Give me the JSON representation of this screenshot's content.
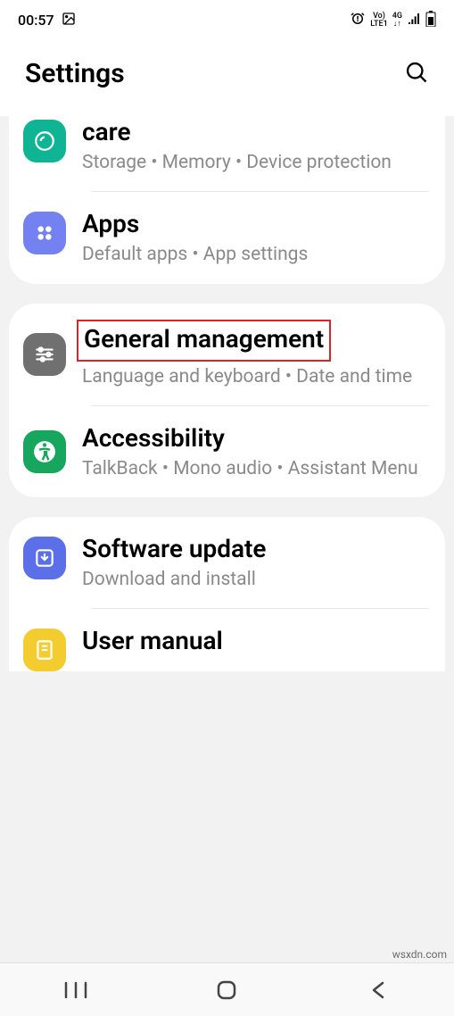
{
  "status": {
    "time": "00:57",
    "vo": "Vo)",
    "lte": "LTE1",
    "net": "4G",
    "arrows": "↓↑"
  },
  "header": {
    "title": "Settings"
  },
  "groups": [
    {
      "items": [
        {
          "key": "care",
          "title": "care",
          "subtitle": "Storage  •  Memory  •  Device protection",
          "iconClass": "icon-care"
        },
        {
          "key": "apps",
          "title": "Apps",
          "subtitle": "Default apps  •  App settings",
          "iconClass": "icon-apps"
        }
      ]
    },
    {
      "items": [
        {
          "key": "general",
          "title": "General management",
          "subtitle": "Language and keyboard  •  Date and time",
          "iconClass": "icon-general",
          "highlight": true
        },
        {
          "key": "accessibility",
          "title": "Accessibility",
          "subtitle": "TalkBack  •  Mono audio  •  Assistant Menu",
          "iconClass": "icon-accessibility"
        }
      ]
    },
    {
      "items": [
        {
          "key": "software",
          "title": "Software update",
          "subtitle": "Download and install",
          "iconClass": "icon-software"
        },
        {
          "key": "manual",
          "title": "User manual",
          "subtitle": "",
          "iconClass": "icon-manual"
        }
      ]
    }
  ],
  "watermark": "wsxdn.com"
}
